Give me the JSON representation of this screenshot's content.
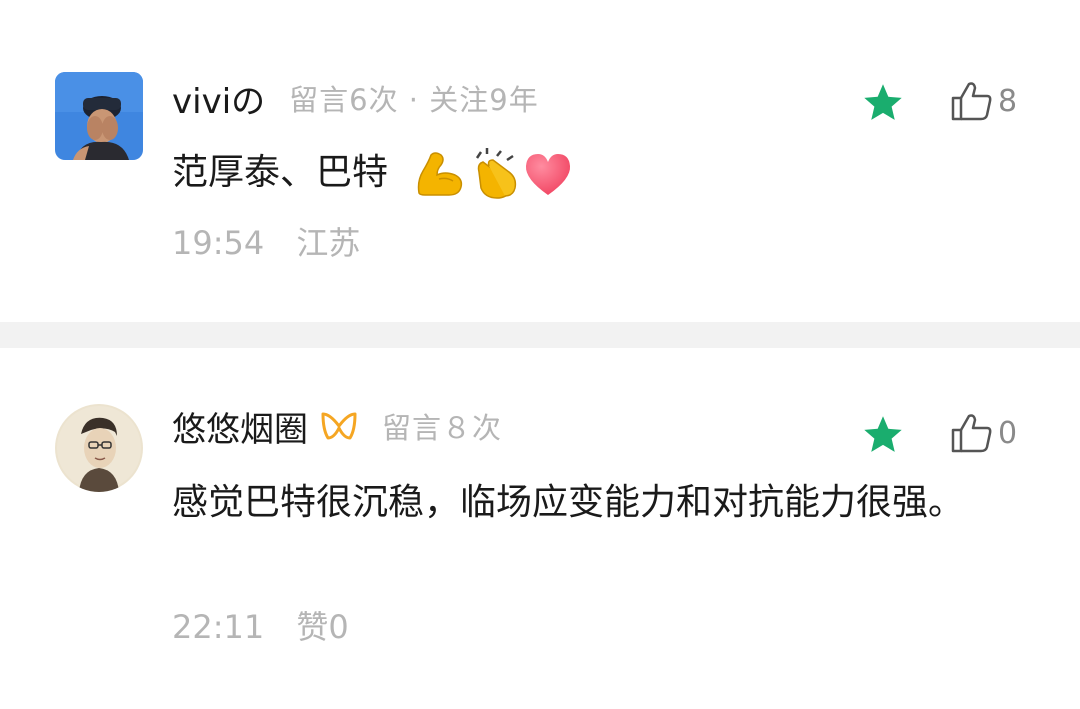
{
  "comments": [
    {
      "username": "viviの",
      "meta": "留言6次 · 关注9年",
      "content": "范厚泰、巴特",
      "emojis": [
        "flexed-biceps-emoji",
        "clapping-hands-emoji",
        "red-heart-emoji"
      ],
      "time": "19:54",
      "location": "江苏",
      "like_count": "8",
      "starred": true
    },
    {
      "username": "悠悠烟圈",
      "meta": "留言８次",
      "content": "感觉巴特很沉稳，临场应变能力和对抗能力很强。",
      "time": "22:11",
      "likes_text": "赞0",
      "like_count": "0",
      "starred": true
    }
  ],
  "icons": {
    "star": "star-icon",
    "like": "thumbs-up-icon",
    "badge": "orange-ribbon-badge-icon"
  },
  "colors": {
    "star": "#1aad6e",
    "meta_text": "#b5b5b5",
    "like_count": "#8a8a8a",
    "divider": "#f2f2f2",
    "badge": "#f5a623"
  }
}
